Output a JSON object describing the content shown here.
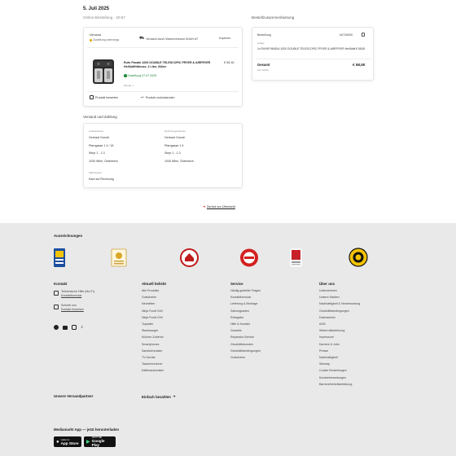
{
  "order": {
    "date": "5. Juli 2025",
    "subtitle": "Online-Bestellung · 20:57",
    "summary_title": "Bestellzusammenfassung"
  },
  "shipment": {
    "status_label": "Versand",
    "status_value": "Zustellung unterwegs",
    "tracking_text": "Versand durch Warenversand GmbH AT",
    "tracking_action": "Kopieren",
    "product_name": "Ruhr Panda! 4200 DOUBLE TELESCOPIC FRYER & AIRFRYER Heißluftfritteuse, 2 Liter, Silber",
    "product_name_2": "",
    "product_qty": "1 Stück",
    "product_price": "€ 58,50",
    "delivery_label": "Zustellung 07.07.2025",
    "product_note": "Menge: 1",
    "review_action": "Produkt bewerten",
    "return_action": "Produkt zurücksenden"
  },
  "summary": {
    "order_no_label": "Bestellung",
    "order_no_value": "#0728390",
    "copy_icon": "copy-icon",
    "items_label": "Artikel",
    "line_item": "1x RUHR PANDA! 4200 DOUBLE TELESCOPIC FRYER & AIRFRYER Heißluftfritteuse N...",
    "line_price": "€ 58,50",
    "total_label": "Gesamt",
    "total_note": "inkl. MwSt.",
    "total_value": "€ 58,50"
  },
  "address_payment": {
    "section_title": "Versand und Zahlung",
    "shipping": {
      "title": "Lieferadresse",
      "name": "Gerhard Gorodi",
      "street": "Pfarrgasse 1 4 / 18",
      "city": "Steyr 1 - 1.3",
      "zip": "1030 Wien, Österreich"
    },
    "billing": {
      "title": "Rechnungsadresse",
      "name": "Gerhard Gorodi",
      "street": "Pfarrgasse 1 4",
      "city": "Steyr 1 - 1.3",
      "zip": "1030 Wien, Österreich"
    },
    "payment_title": "Zahlungsart",
    "payment_value": "Kauf auf Rechnung"
  },
  "return_link": "Zurück zur Übersicht",
  "footer": {
    "awards_title": "Auszeichnungen",
    "badges": [
      "trusted-shops-icon",
      "award-icon",
      "quality-seal-icon",
      "best-shop-icon",
      "gold-award-icon",
      "ehi-seal-icon"
    ],
    "contact": {
      "title": "Kontakt",
      "phone_line1": "Telefonische Hilfe (Mo-Fr)",
      "phone_line2": "Kontaktformular",
      "mail_line1": "Schreib uns",
      "mail_line2": "Kontakt einsehen",
      "social": [
        "facebook-icon",
        "youtube-icon",
        "instagram-icon",
        "tiktok-icon"
      ]
    },
    "col1": {
      "title": "Aktuell beliebt",
      "links": [
        "Alle Produkte",
        "Gutscheine",
        "Neuheiten",
        "Ninja Foodi Grill",
        "Ninja Foodi Grill",
        "Topseller",
        "Staubsauger",
        "Küchen-Zubehör",
        "Smartphones",
        "Sandwichmaker",
        "TV-Geräte",
        "Taschenrechner",
        "Kaffeeautomaten"
      ]
    },
    "col2": {
      "title": "Service",
      "links": [
        "Häufig gestellte Fragen",
        "Kontaktformular",
        "Lieferung & Montage",
        "Zahlungsarten",
        "Rückgabe",
        "Hilfe & Kontakt",
        "Garantie",
        "Reparatur-Service",
        "Geschäftskunden",
        "Geschäftsbedingungen",
        "Gutscheine"
      ]
    },
    "col3": {
      "title": "Über uns",
      "links": [
        "Unternehmen",
        "Unsere Marken",
        "Nachhaltigkeit & Verantwortung",
        "Geschäftsbedingungen",
        "Datenschutz",
        "AGB",
        "Widerrufsbelehrung",
        "Impressum",
        "Karriere & Jobs",
        "Presse",
        "Nachhaltigkeit",
        "Sitemap",
        "Cookie Einstellungen",
        "Kundenbewertungen",
        "Barrierefreiheitserklärung"
      ]
    },
    "partners_title": "Unsere Versandpartner",
    "easy_pay_title": "Einfach bezahlen",
    "app_title": "Mediamarkt App — jetzt herunterladen",
    "app_store_line1": "Laden im",
    "app_store_line2": "App Store",
    "play_store_line1": "JETZT BEI",
    "play_store_line2": "Google Play"
  }
}
